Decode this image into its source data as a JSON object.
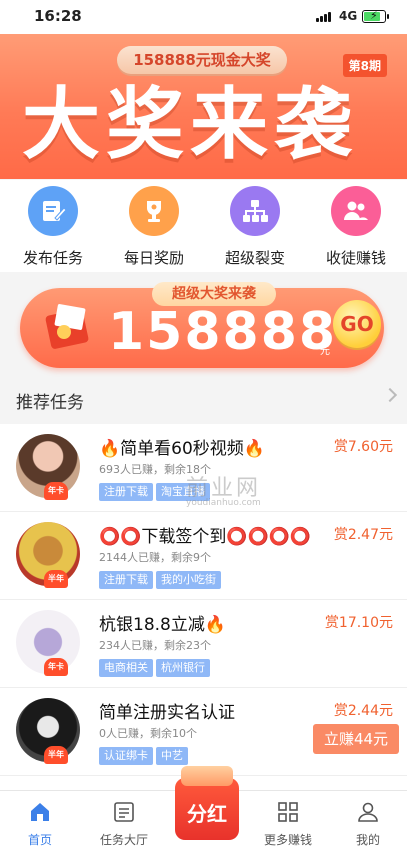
{
  "status": {
    "time": "16:28",
    "network": "4G"
  },
  "banner": {
    "ribbon": "158888元现金大奖",
    "period": "第8期",
    "headline": "大奖来袭"
  },
  "quick_links": [
    {
      "label": "发布任务",
      "icon": "edit-icon",
      "color": "#5ea2f6"
    },
    {
      "label": "每日奖励",
      "icon": "trophy-icon",
      "color": "#ffa14b"
    },
    {
      "label": "超级裂变",
      "icon": "network-icon",
      "color": "#9a79f1"
    },
    {
      "label": "收徒赚钱",
      "icon": "users-icon",
      "color": "#fb5e97"
    }
  ],
  "prize": {
    "tag": "超级大奖来袭",
    "amount": "158888",
    "unit": "元",
    "go": "GO"
  },
  "recommend": {
    "title": "推荐任务"
  },
  "tasks": [
    {
      "title": "🔥简单看60秒视频🔥",
      "meta": "693人已赚，剩余18个",
      "tags": [
        "注册下载",
        "淘宝直播"
      ],
      "reward": "赏7.60元",
      "badge": "年卡"
    },
    {
      "title": "⭕⭕下载签个到⭕⭕⭕⭕",
      "meta": "2144人已赚，剩余9个",
      "tags": [
        "注册下载",
        "我的小吃街"
      ],
      "reward": "赏2.47元",
      "badge": "半年"
    },
    {
      "title": "杭银18.8立减🔥",
      "meta": "234人已赚，剩余23个",
      "tags": [
        "电商相关",
        "杭州银行"
      ],
      "reward": "赏17.10元",
      "badge": "年卡"
    },
    {
      "title": "简单注册实名认证",
      "meta": "0人已赚，剩余10个",
      "tags": [
        "认证绑卡",
        "中艺"
      ],
      "reward": "赏2.44元",
      "badge": "半年",
      "button": "立赚44元"
    }
  ],
  "watermark": {
    "text": "前业网",
    "url": "youdianhuo.com"
  },
  "tabbar": {
    "items": [
      {
        "label": "首页",
        "icon": "home-icon",
        "active": true
      },
      {
        "label": "任务大厅",
        "icon": "list-icon"
      },
      {
        "label": "更多赚钱",
        "icon": "grid-icon"
      },
      {
        "label": "我的",
        "icon": "person-icon"
      }
    ],
    "center": "分红"
  }
}
